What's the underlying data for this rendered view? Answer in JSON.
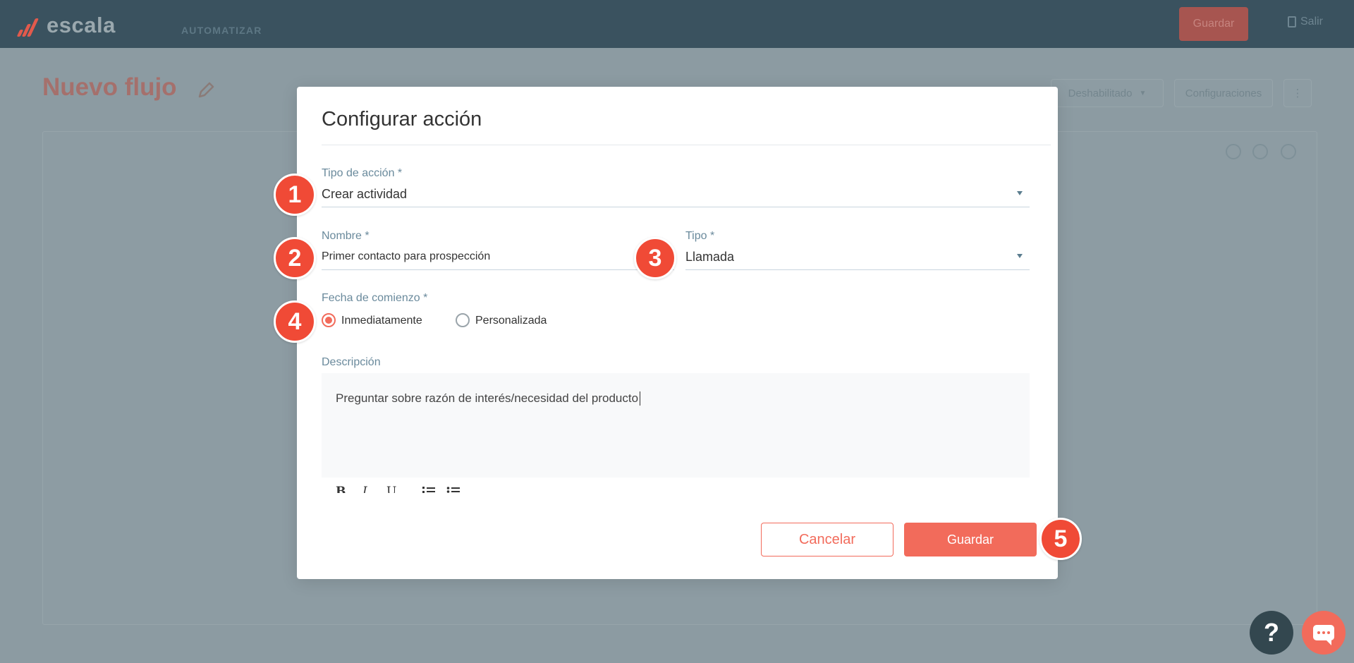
{
  "app": {
    "logo_text": "escala",
    "nav_item": "AUTOMATIZAR",
    "top_save_label": "Guardar",
    "exit_label": "Salir",
    "flow_title": "Nuevo flujo",
    "status_label": "Deshabilitado",
    "config_label": "Configuraciones"
  },
  "modal": {
    "title": "Configurar acción",
    "action_type": {
      "label": "Tipo de acción *",
      "value": "Crear actividad"
    },
    "name": {
      "label": "Nombre *",
      "value": "Primer contacto para prospección"
    },
    "type": {
      "label": "Tipo *",
      "value": "Llamada"
    },
    "start_date": {
      "label": "Fecha de comienzo *",
      "options": [
        {
          "label": "Inmediatamente",
          "selected": true
        },
        {
          "label": "Personalizada",
          "selected": false
        }
      ]
    },
    "description": {
      "label": "Descripción",
      "value": "Preguntar sobre razón de interés/necesidad del producto",
      "toolbar": {
        "bold": "B",
        "italic": "I",
        "underline": "U"
      }
    },
    "cancel_label": "Cancelar",
    "save_label": "Guardar"
  },
  "steps": [
    "1",
    "2",
    "3",
    "4",
    "5"
  ],
  "help_label": "?",
  "colors": {
    "accent": "#f26b5b",
    "badge": "#f04a36",
    "topbar": "#3a525f",
    "overlay_bg": "#8c9ba2"
  }
}
